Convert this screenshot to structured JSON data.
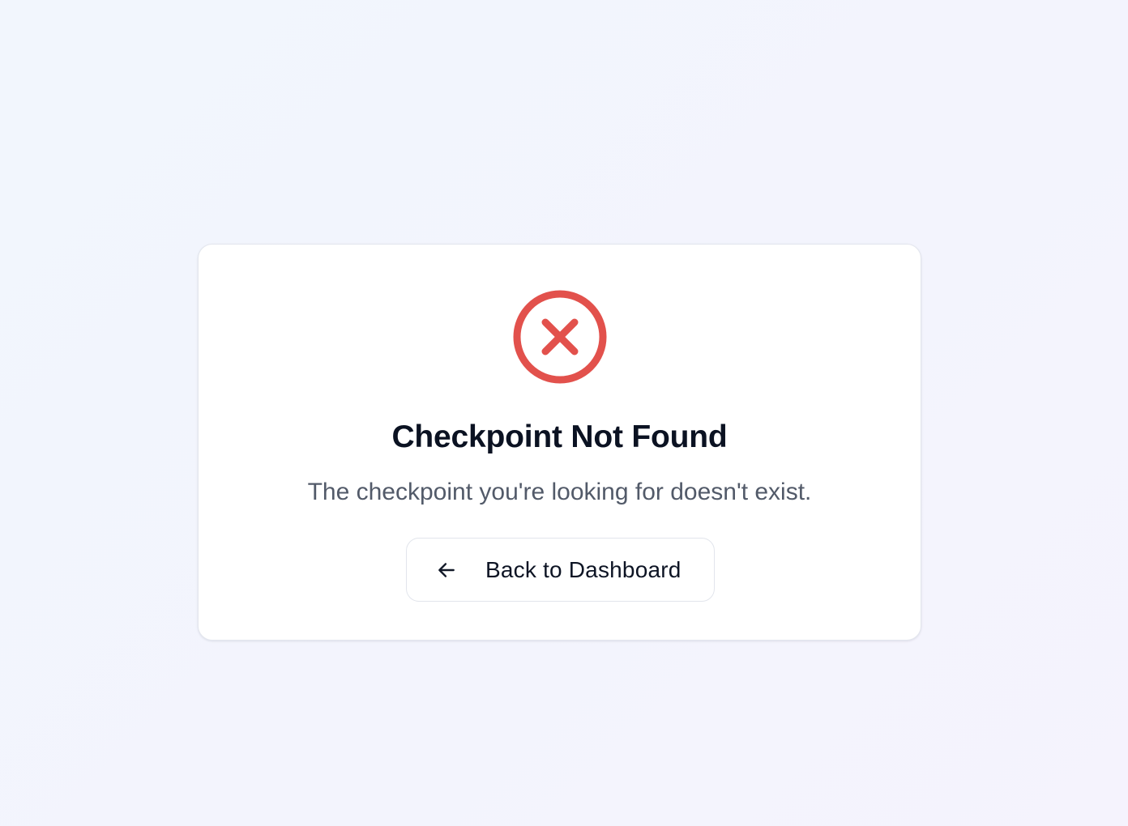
{
  "error_card": {
    "icon": "x-circle-icon",
    "icon_color": "#e2514c",
    "title": "Checkpoint Not Found",
    "message": "The checkpoint you're looking for doesn't exist.",
    "back_button": {
      "icon": "arrow-left-icon",
      "label": "Back to Dashboard"
    }
  }
}
